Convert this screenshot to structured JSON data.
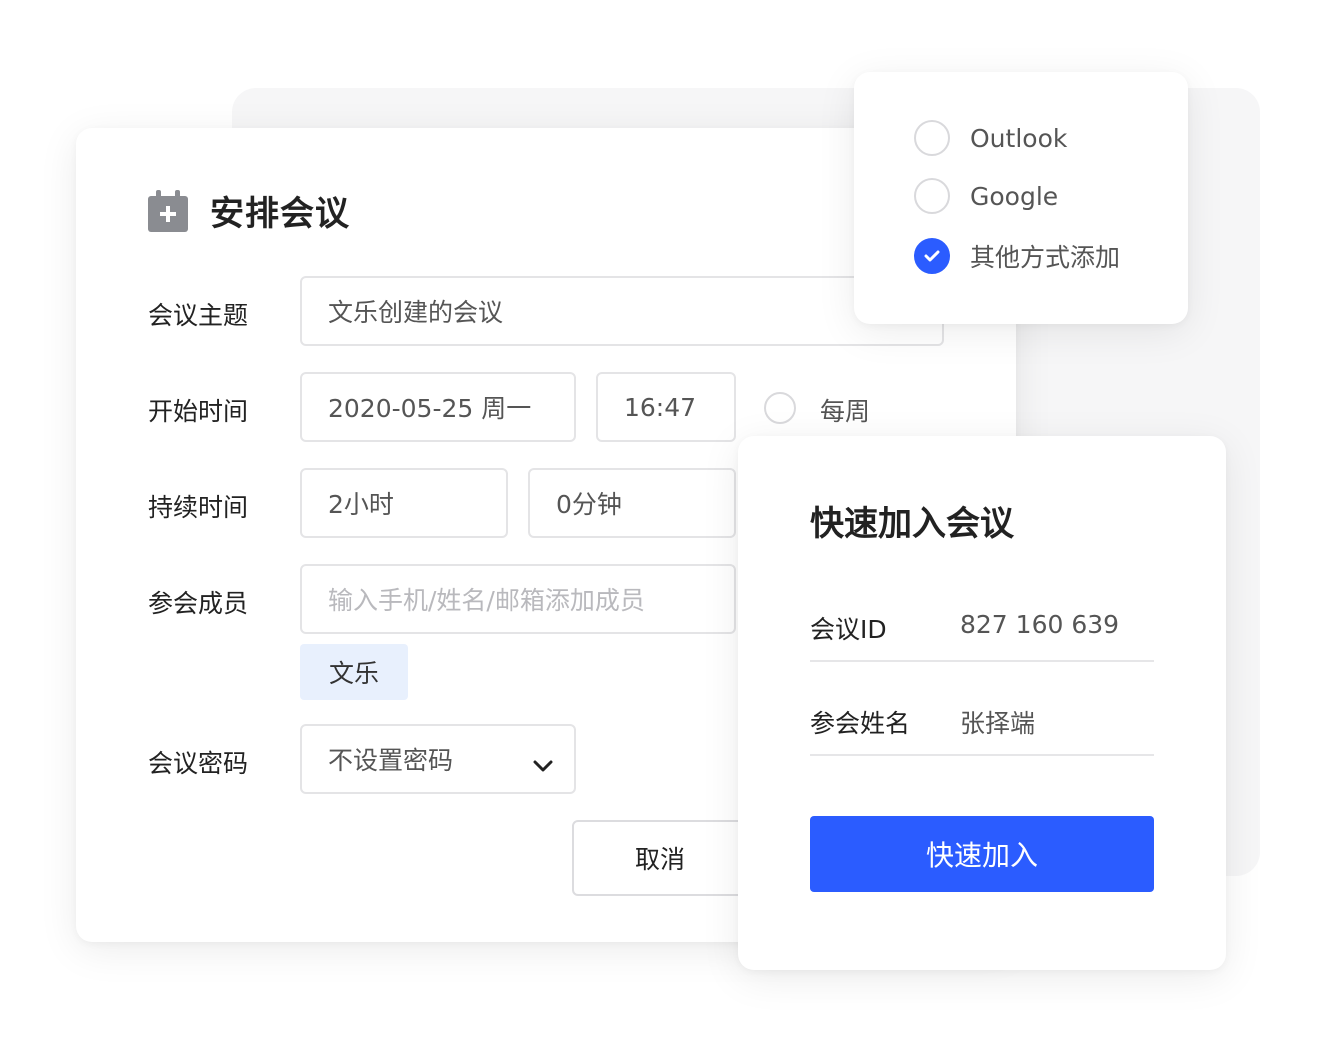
{
  "schedule_meeting": {
    "title": "安排会议",
    "fields": {
      "topic": {
        "label": "会议主题",
        "value": "文乐创建的会议"
      },
      "start_time": {
        "label": "开始时间",
        "date": "2020-05-25 周一",
        "time": "16:47",
        "repeat_label": "每周"
      },
      "duration": {
        "label": "持续时间",
        "hours": "2小时",
        "minutes": "0分钟"
      },
      "members": {
        "label": "参会成员",
        "placeholder": "输入手机/姓名/邮箱添加成员",
        "chips": [
          "文乐"
        ]
      },
      "password": {
        "label": "会议密码",
        "selected": "不设置密码"
      }
    },
    "cancel_label": "取消"
  },
  "calendar_options": {
    "items": [
      {
        "label": "Outlook",
        "checked": false
      },
      {
        "label": "Google",
        "checked": false
      },
      {
        "label": "其他方式添加",
        "checked": true
      }
    ]
  },
  "quick_join": {
    "title": "快速加入会议",
    "meeting_id": {
      "label": "会议ID",
      "value": "827 160 639"
    },
    "name": {
      "label": "参会姓名",
      "value": "张择端"
    },
    "join_label": "快速加入"
  },
  "colors": {
    "accent": "#2b5cff",
    "chip_bg": "#e8f0fd",
    "icon_gray": "#8a8c91"
  },
  "icons": [
    "calendar-add-icon",
    "chevron-down-icon",
    "check-icon"
  ]
}
